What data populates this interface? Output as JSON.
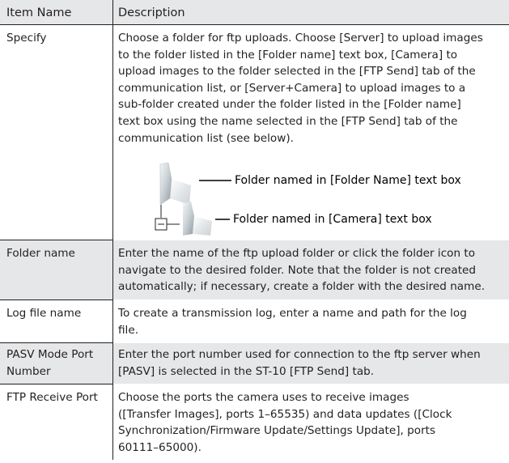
{
  "table": {
    "header": {
      "col1": "Item Name",
      "col2": "Description"
    },
    "rows": [
      {
        "name": "Specify",
        "lines": [
          "Choose a folder for ftp uploads. Choose [Server] to upload images",
          "to the folder listed in the [Folder name] text box, [Camera] to",
          "upload images to the folder selected in the [FTP Send] tab of the",
          "communication list, or [Server+Camera] to upload images to a",
          "sub-folder created under the folder listed in the [Folder name]",
          "text box using the name selected in the [FTP Send] tab of the",
          "communication list (see below)."
        ]
      },
      {
        "name": "Folder name",
        "lines": [
          "Enter the name of the ftp upload folder or click the folder icon to",
          "navigate to the desired folder. Note that the folder is not created",
          "automatically; if necessary, create a folder with the desired name."
        ]
      },
      {
        "name": "Log file name",
        "lines": [
          "To create a transmission log, enter a name and path for the log",
          "file."
        ]
      },
      {
        "name_lines": [
          "PASV Mode Port",
          "Number"
        ],
        "lines": [
          "Enter the port number used for connection to the ftp server when",
          "[PASV] is selected in the ST-10 [FTP Send] tab."
        ]
      },
      {
        "name": "FTP Receive Port",
        "lines": [
          "Choose the ports the camera uses to receive images",
          "([Transfer Images], ports 1–65535) and data updates ([Clock",
          "Synchronization/Firmware Update/Settings Update], ports",
          "60111–65000)."
        ]
      }
    ]
  },
  "diagram": {
    "label_top": "Folder named in [Folder Name] text box",
    "label_bottom": "Folder named in [Camera] text box",
    "colors": {
      "shade": "#e6e7e8",
      "line": "#231f20"
    }
  }
}
